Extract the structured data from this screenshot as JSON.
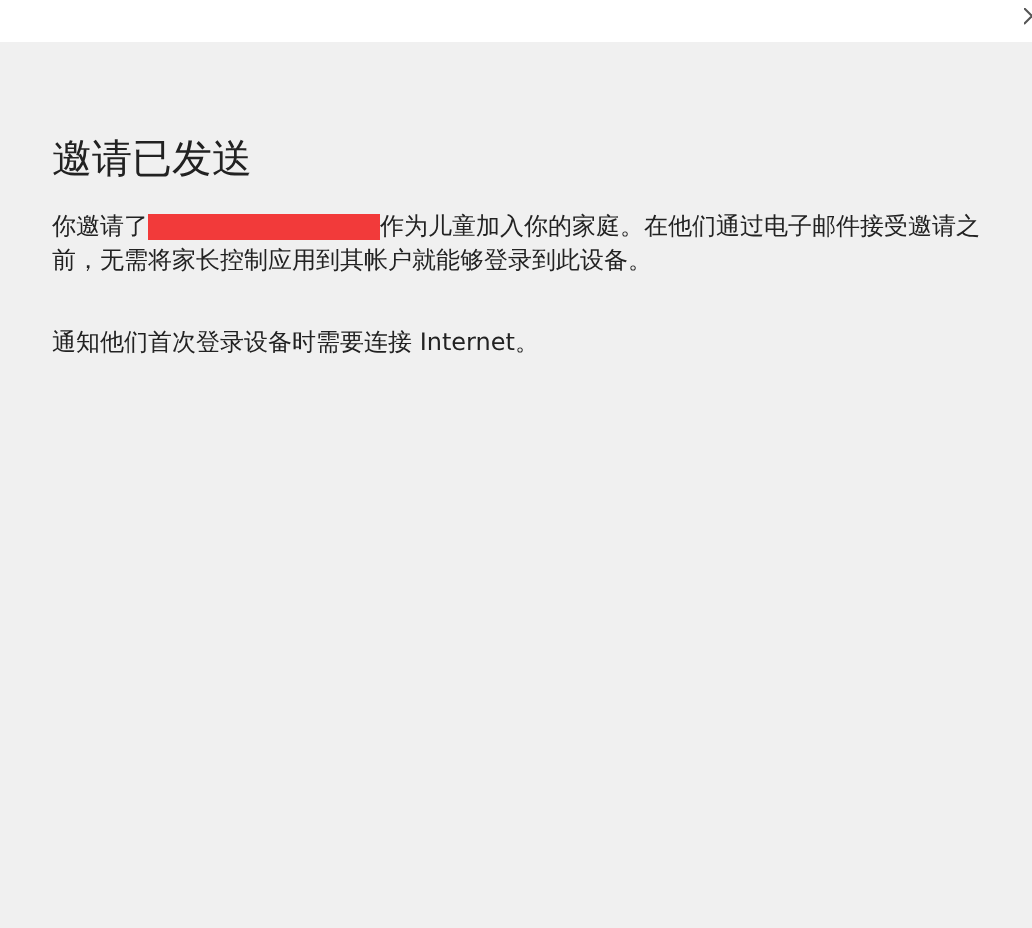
{
  "dialog": {
    "title": "邀请已发送",
    "message": {
      "before": "你邀请了",
      "redacted": true,
      "lines": [
        "作为儿童加入你的家庭。在他们通过电子邮件接受邀请之",
        "前，无需将家长控制应用到其帐户就能够登录到此设备。"
      ]
    },
    "note": "通知他们首次登录设备时需要连接 Internet。"
  }
}
